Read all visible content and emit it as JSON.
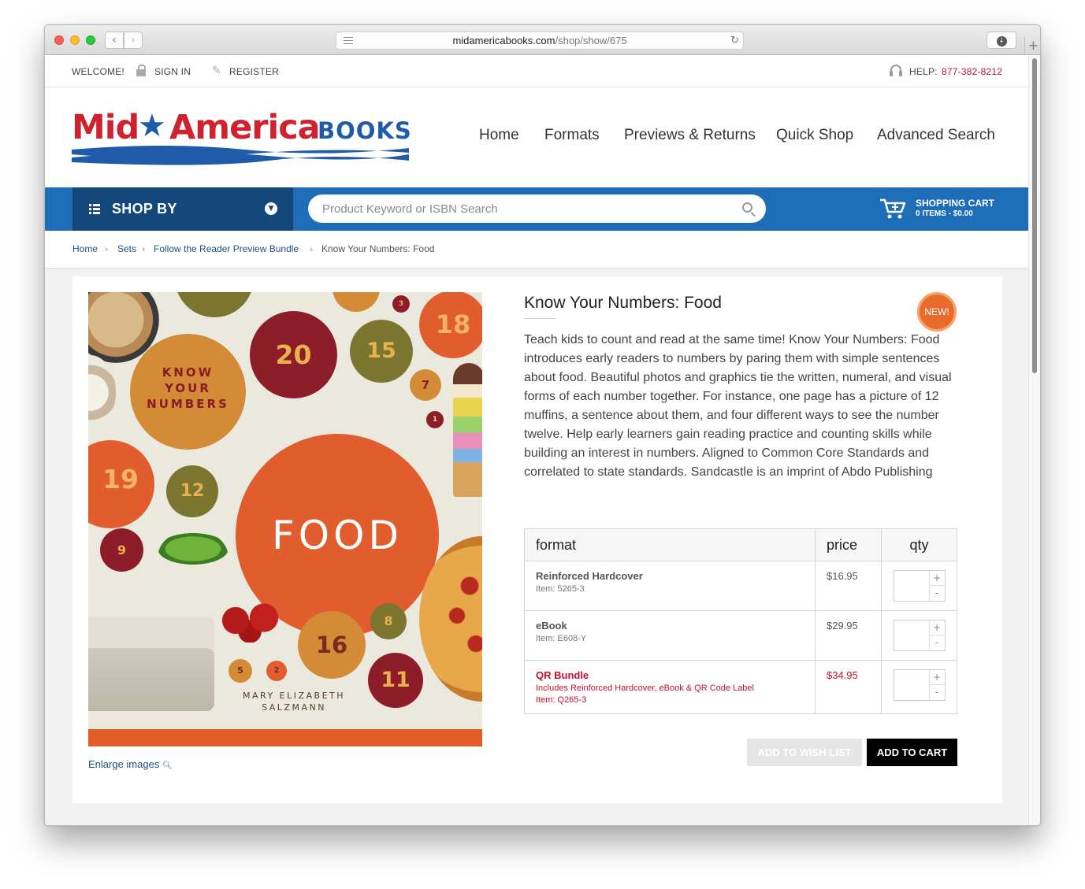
{
  "browser": {
    "url_domain": "midamericabooks.com",
    "url_path": "/shop/show/675"
  },
  "topbar": {
    "welcome": "WELCOME!",
    "sign_in": "SIGN IN",
    "register": "REGISTER",
    "help_label": "HELP:",
    "help_phone": "877-382-8212"
  },
  "logo": {
    "mid": "Mid",
    "star": "★",
    "america": "America",
    "books": "BOOKS"
  },
  "nav": [
    "Home",
    "Formats",
    "Previews & Returns",
    "Quick Shop",
    "Advanced Search"
  ],
  "shop_by": "SHOP BY",
  "search": {
    "placeholder": "Product Keyword or ISBN Search"
  },
  "cart": {
    "title": "SHOPPING CART",
    "summary": "0 ITEMS - $0.00"
  },
  "breadcrumb": [
    "Home",
    "Sets",
    "Follow the Reader Preview Bundle",
    "Know Your Numbers: Food"
  ],
  "cover": {
    "title": "FOOD",
    "series_lines": [
      "KNOW",
      "YOUR",
      "NUMBERS"
    ],
    "author_lines": [
      "MARY ELIZABETH",
      "SALZMANN"
    ],
    "numbers": [
      "20",
      "15",
      "18",
      "19",
      "12",
      "9",
      "16",
      "8",
      "11",
      "7",
      "3",
      "1",
      "5",
      "2"
    ]
  },
  "enlarge": "Enlarge images",
  "product": {
    "title": "Know Your Numbers: Food",
    "badge": "NEW!",
    "description": "Teach kids to count and read at the same time! Know Your Numbers: Food introduces early readers to numbers by paring them with simple sentences about food. Beautiful photos and graphics tie the written, numeral, and visual forms of each number together. For instance, one page has a picture of 12 muffins, a sentence about them, and four different ways to see the number twelve. Help early learners gain reading practice and counting skills while building an interest in numbers. Aligned to Common Core Standards and correlated to state standards. Sandcastle is an imprint of Abdo Publishing"
  },
  "formats_table": {
    "headers": {
      "format": "format",
      "price": "price",
      "qty": "qty"
    },
    "rows": [
      {
        "name": "Reinforced Hardcover",
        "item": "Item: 5265-3",
        "price": "$16.95"
      },
      {
        "name": "eBook",
        "item": "Item: E608-Y",
        "price": "$29.95"
      },
      {
        "name": "QR Bundle",
        "includes": "Includes Reinforced Hardcover, eBook & QR Code Label",
        "item": "Item: Q265-3",
        "price": "$34.95"
      }
    ],
    "plus": "+",
    "minus": "-"
  },
  "buttons": {
    "wish": "ADD TO WISH LIST",
    "cart": "ADD TO CART"
  },
  "colors": {
    "brand_red": "#d0222e",
    "brand_blue": "#1e6db7",
    "dark_blue": "#14487a",
    "cover_orange": "#e15d2e"
  }
}
